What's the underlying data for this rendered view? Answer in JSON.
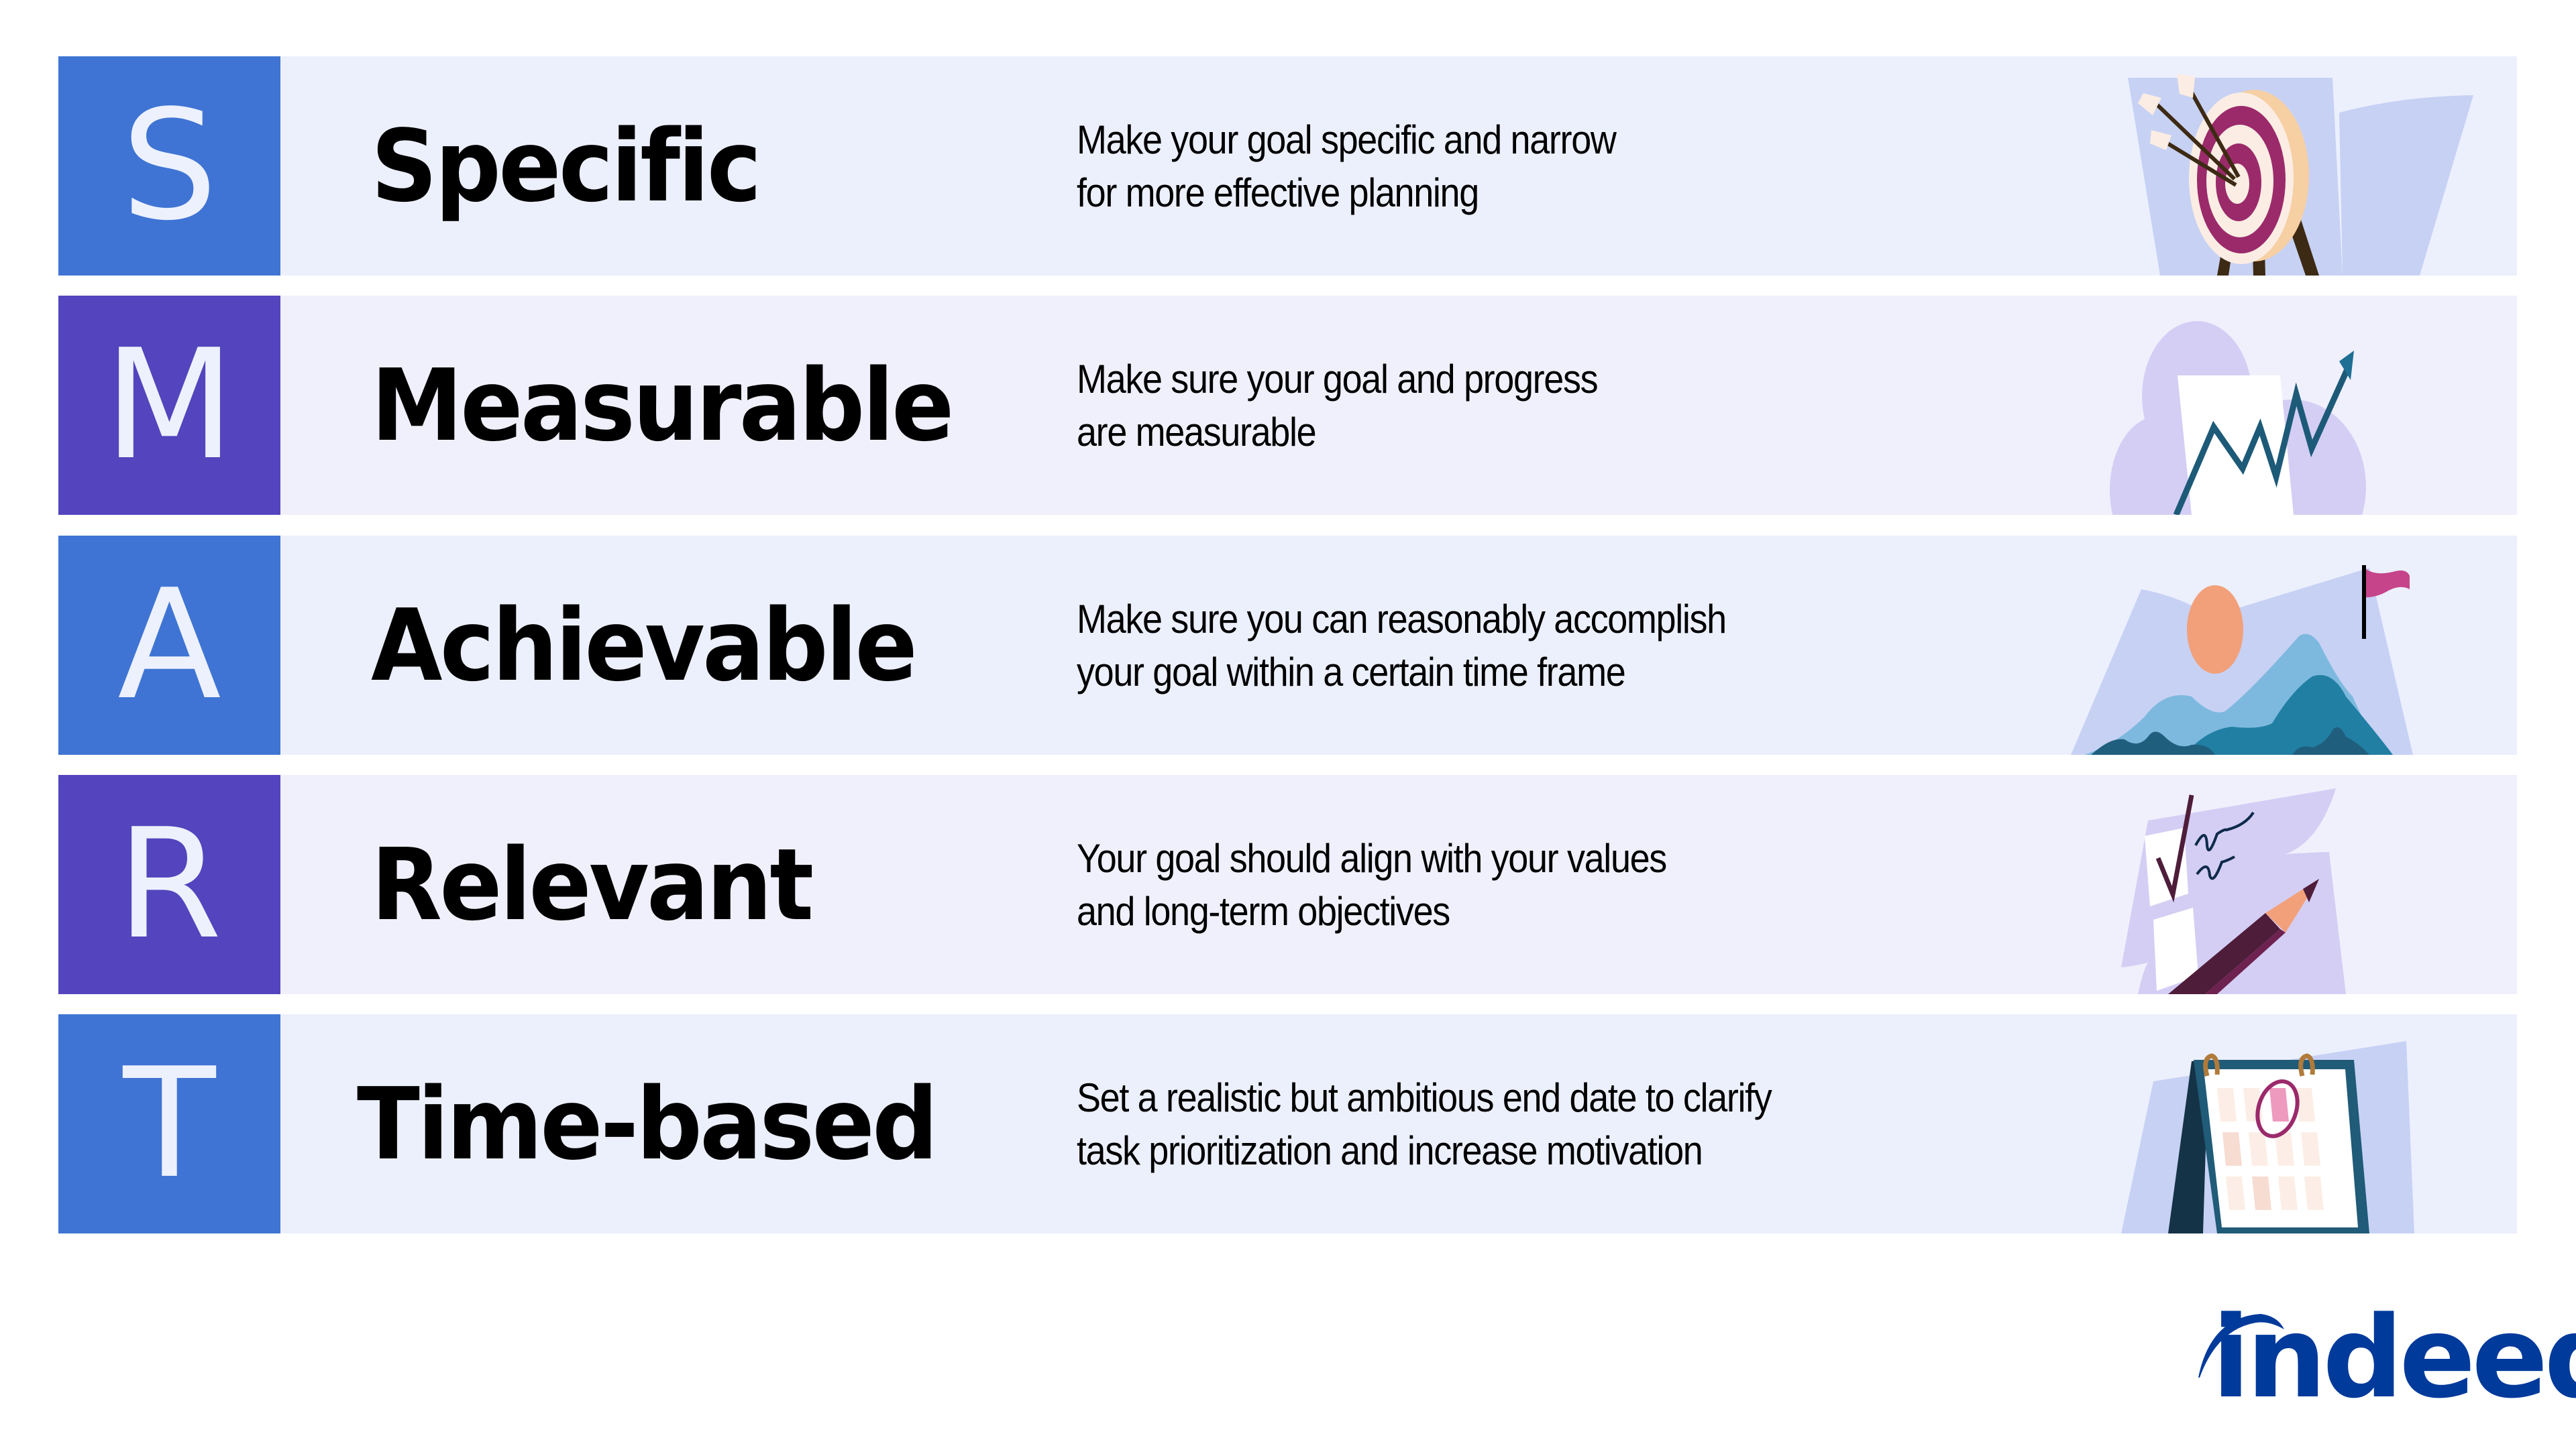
{
  "rows": [
    {
      "letter": "S",
      "title": "Specific",
      "description": [
        "Make your goal specific and narrow",
        "for more effective planning"
      ],
      "tile_color": "#3F74D4",
      "illustration": "target-with-arrows-icon"
    },
    {
      "letter": "M",
      "title": "Measurable",
      "description": [
        "Make sure your goal and progress",
        "are measurable"
      ],
      "tile_color": "#5444BD",
      "illustration": "rising-chart-icon"
    },
    {
      "letter": "A",
      "title": "Achievable",
      "description": [
        "Make sure you can reasonably accomplish",
        "your goal within a certain time frame"
      ],
      "tile_color": "#3F74D4",
      "illustration": "mountain-flag-icon"
    },
    {
      "letter": "R",
      "title": "Relevant",
      "description": [
        "Your goal should align with your values",
        "and long-term objectives"
      ],
      "tile_color": "#5444BD",
      "illustration": "checklist-pencil-icon"
    },
    {
      "letter": "T",
      "title": "Time-based",
      "description": [
        "Set a realistic but ambitious end date to clarify",
        "task prioritization and increase motivation"
      ],
      "tile_color": "#3F74D4",
      "illustration": "calendar-icon"
    }
  ],
  "brand": {
    "name": "indeed",
    "color": "#003A9B"
  },
  "colors": {
    "row_bg_blue": "#ECF0FD",
    "row_bg_purple": "#F0F0FD",
    "letter": "#EDF1FD"
  }
}
